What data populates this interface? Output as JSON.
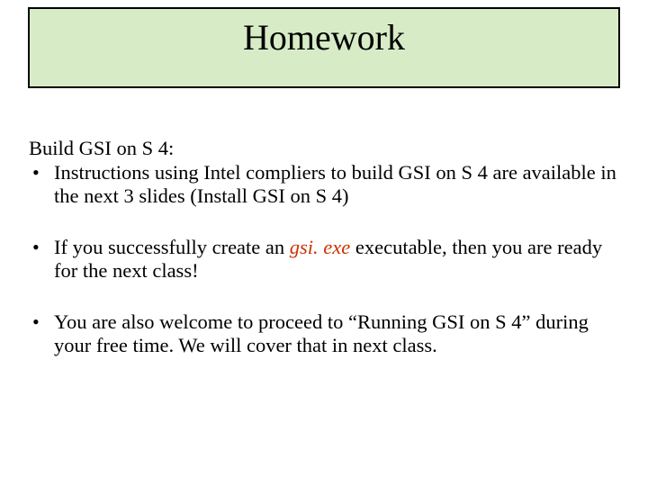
{
  "title": "Homework",
  "intro": "Build GSI on S 4:",
  "bullets": {
    "b1": "Instructions using Intel compliers to build GSI on S 4 are available in the next 3 slides (Install GSI on S 4)",
    "b2_pre": "If you successfully create an ",
    "b2_hl": "gsi. exe",
    "b2_post": " executable, then you are ready for the next class!",
    "b3": "You are also welcome to proceed to “Running GSI on S 4” during your free time. We will cover that in next class."
  }
}
